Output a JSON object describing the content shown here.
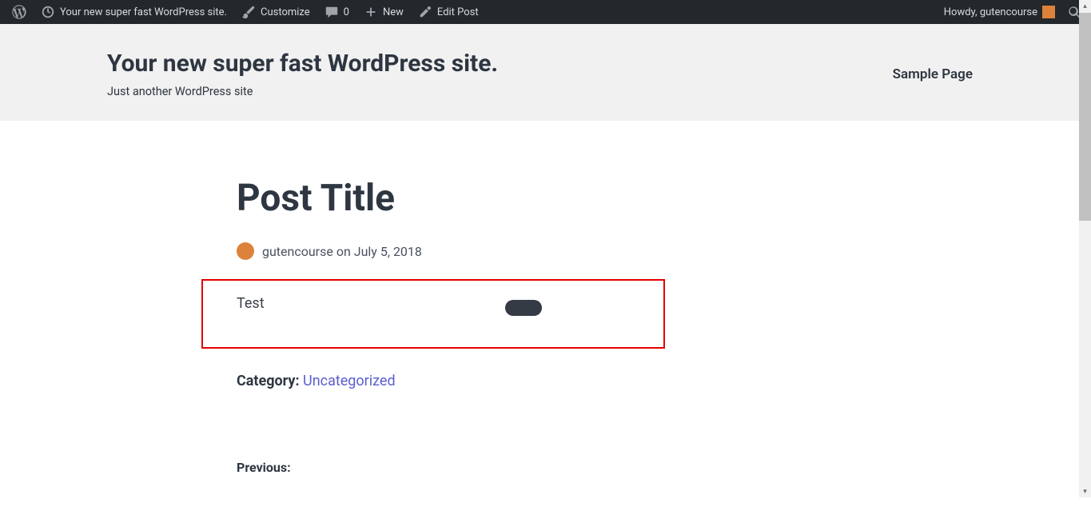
{
  "adminbar": {
    "site_name": "Your new super fast WordPress site.",
    "customize": "Customize",
    "comments_count": "0",
    "new": "New",
    "edit_post": "Edit Post",
    "howdy_prefix": "Howdy, ",
    "username": "gutencourse"
  },
  "header": {
    "site_title": "Your new super fast WordPress site.",
    "tagline": "Just another WordPress site",
    "nav_item": "Sample Page"
  },
  "post": {
    "title": "Post Title",
    "author": "gutencourse",
    "byline_middle": " on ",
    "date": "July 5, 2018",
    "body": "Test",
    "category_label": "Category: ",
    "category": "Uncategorized",
    "previous_label": "Previous:"
  }
}
